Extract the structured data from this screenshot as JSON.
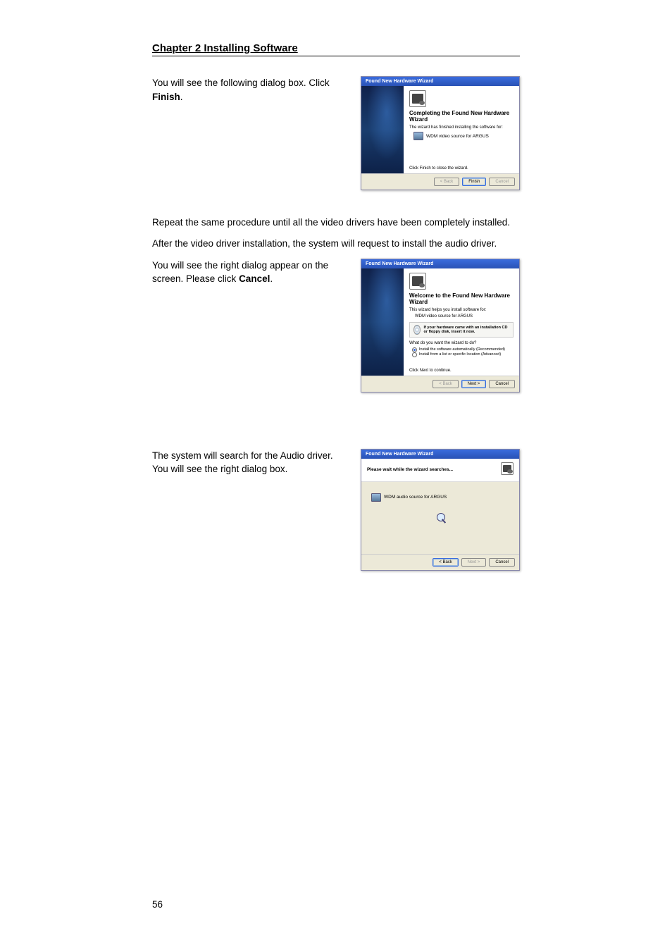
{
  "header": "Chapter 2 Installing Software",
  "section1": {
    "text_before_bold": "You will see the following dialog box. Click ",
    "bold_word": "Finish",
    "text_after_bold": "."
  },
  "dialog1": {
    "window_title": "Found New Hardware Wizard",
    "heading": "Completing the Found New Hardware Wizard",
    "line1": "The wizard has finished installing the software for:",
    "item": "WDM video source for ARGUS",
    "bottom_text": "Click Finish to close the wizard.",
    "btn_back": "< Back",
    "btn_finish": "Finish",
    "btn_cancel": "Cancel"
  },
  "para_repeat": "Repeat the same procedure until all the video drivers have been completely installed.",
  "para_after": "After the video driver installation, the system will request to install the audio driver.",
  "section2": {
    "text_before_bold": "You will see the right dialog appear on the screen. Please click ",
    "bold_word": "Cancel",
    "text_after_bold": "."
  },
  "dialog2": {
    "window_title": "Found New Hardware Wizard",
    "heading": "Welcome to the Found New Hardware Wizard",
    "line1": "This wizard helps you install software for:",
    "item": "WDM video source for ARGUS",
    "cd_note": "If your hardware came with an installation CD or floppy disk, insert it now.",
    "question": "What do you want the wizard to do?",
    "opt1": "Install the software automatically (Recommended)",
    "opt2": "Install from a list or specific location (Advanced)",
    "bottom_text": "Click Next to continue.",
    "btn_back": "< Back",
    "btn_next": "Next >",
    "btn_cancel": "Cancel"
  },
  "section3_line1": "The system will search for the Audio driver.",
  "section3_line2": "You will see the right dialog box.",
  "dialog3": {
    "window_title": "Found New Hardware Wizard",
    "head_text": "Please wait while the wizard searches...",
    "item": "WDM audio source for ARGUS",
    "btn_back": "< Back",
    "btn_next": "Next >",
    "btn_cancel": "Cancel"
  },
  "page_number": "56"
}
